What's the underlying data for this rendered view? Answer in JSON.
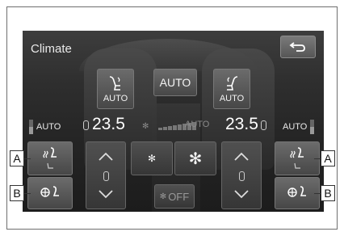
{
  "screen": {
    "title": "Climate"
  },
  "top_buttons": {
    "driver_auto_label": "AUTO",
    "center_auto_label": "AUTO",
    "passenger_auto_label": "AUTO"
  },
  "readout": {
    "driver_mode": "AUTO",
    "driver_temp": "23.5",
    "fan_mode": "AUTO",
    "passenger_temp": "23.5",
    "passenger_mode": "AUTO"
  },
  "bottom": {
    "off_label": "OFF"
  },
  "callouts": {
    "a_left": "A",
    "b_left": "B",
    "a_right": "A",
    "b_right": "B"
  },
  "colors": {
    "screen_bg": "#2e2e2e",
    "button": "#5a5a5a",
    "text": "#ffffff"
  }
}
